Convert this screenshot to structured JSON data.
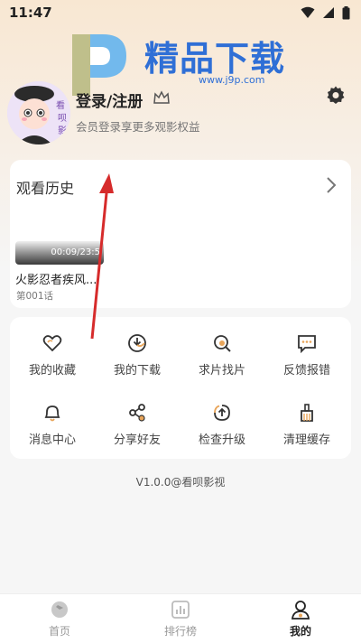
{
  "status_bar": {
    "time": "11:47"
  },
  "watermark": {
    "title": "精品下载",
    "url": "www.j9p.com"
  },
  "profile": {
    "login_label": "登录/注册",
    "subtitle": "会员登录享更多观影权益",
    "avatar_text": "看呗影视"
  },
  "history": {
    "title": "观看历史",
    "items": [
      {
        "time": "00:09/23:5",
        "name": "火影忍者疾风...",
        "episode": "第001话"
      }
    ]
  },
  "features": [
    {
      "label": "我的收藏",
      "icon": "heart-icon"
    },
    {
      "label": "我的下载",
      "icon": "download-icon"
    },
    {
      "label": "求片找片",
      "icon": "search-film-icon"
    },
    {
      "label": "反馈报错",
      "icon": "feedback-icon"
    },
    {
      "label": "消息中心",
      "icon": "bell-icon"
    },
    {
      "label": "分享好友",
      "icon": "share-icon"
    },
    {
      "label": "检查升级",
      "icon": "upgrade-icon"
    },
    {
      "label": "清理缓存",
      "icon": "broom-icon"
    }
  ],
  "version": "V1.0.0@看呗影视",
  "bottom_nav": [
    {
      "label": "首页",
      "icon": "home-icon",
      "active": false
    },
    {
      "label": "排行榜",
      "icon": "ranking-icon",
      "active": false
    },
    {
      "label": "我的",
      "icon": "profile-icon",
      "active": true
    }
  ],
  "colors": {
    "accent": "#e8a55a",
    "brand": "#2f6fd6",
    "annotation": "#d62b2b"
  }
}
